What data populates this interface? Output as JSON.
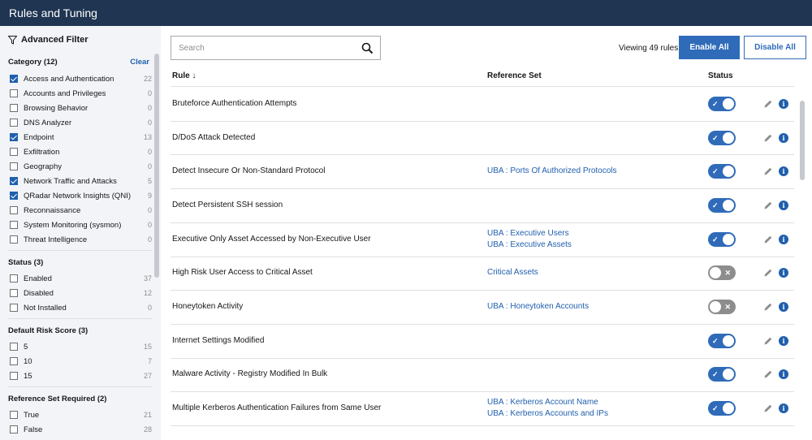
{
  "app": {
    "title": "Rules and Tuning"
  },
  "sidebar": {
    "title": "Advanced Filter",
    "clear_label": "Clear",
    "groups": [
      {
        "title": "Category (12)",
        "items": [
          {
            "label": "Access and Authentication",
            "count": "22",
            "checked": true
          },
          {
            "label": "Accounts and Privileges",
            "count": "0",
            "checked": false
          },
          {
            "label": "Browsing Behavior",
            "count": "0",
            "checked": false
          },
          {
            "label": "DNS Analyzer",
            "count": "0",
            "checked": false
          },
          {
            "label": "Endpoint",
            "count": "13",
            "checked": true
          },
          {
            "label": "Exfiltration",
            "count": "0",
            "checked": false
          },
          {
            "label": "Geography",
            "count": "0",
            "checked": false
          },
          {
            "label": "Network Traffic and Attacks",
            "count": "5",
            "checked": true
          },
          {
            "label": "QRadar Network Insights (QNI)",
            "count": "9",
            "checked": true
          },
          {
            "label": "Reconnaissance",
            "count": "0",
            "checked": false
          },
          {
            "label": "System Monitoring (sysmon)",
            "count": "0",
            "checked": false
          },
          {
            "label": "Threat Intelligence",
            "count": "0",
            "checked": false
          }
        ]
      },
      {
        "title": "Status (3)",
        "items": [
          {
            "label": "Enabled",
            "count": "37",
            "checked": false
          },
          {
            "label": "Disabled",
            "count": "12",
            "checked": false
          },
          {
            "label": "Not Installed",
            "count": "0",
            "checked": false
          }
        ]
      },
      {
        "title": "Default Risk Score (3)",
        "items": [
          {
            "label": "5",
            "count": "15",
            "checked": false
          },
          {
            "label": "10",
            "count": "7",
            "checked": false
          },
          {
            "label": "15",
            "count": "27",
            "checked": false
          }
        ]
      },
      {
        "title": "Reference Set Required (2)",
        "items": [
          {
            "label": "True",
            "count": "21",
            "checked": false
          },
          {
            "label": "False",
            "count": "28",
            "checked": false
          }
        ]
      }
    ]
  },
  "toolbar": {
    "search_placeholder": "Search",
    "viewing_text": "Viewing 49 rules",
    "enable_all_label": "Enable All",
    "disable_all_label": "Disable All"
  },
  "table": {
    "columns": {
      "rule": "Rule ↓",
      "reference_set": "Reference Set",
      "status": "Status"
    },
    "rows": [
      {
        "rule": "Bruteforce Authentication Attempts",
        "refs": [],
        "enabled": true
      },
      {
        "rule": "D/DoS Attack Detected",
        "refs": [],
        "enabled": true
      },
      {
        "rule": "Detect Insecure Or Non-Standard Protocol",
        "refs": [
          "UBA : Ports Of Authorized Protocols"
        ],
        "enabled": true
      },
      {
        "rule": "Detect Persistent SSH session",
        "refs": [],
        "enabled": true
      },
      {
        "rule": "Executive Only Asset Accessed by Non-Executive User",
        "refs": [
          "UBA : Executive Users",
          "UBA : Executive Assets"
        ],
        "enabled": true
      },
      {
        "rule": "High Risk User Access to Critical Asset",
        "refs": [
          "Critical Assets"
        ],
        "enabled": false
      },
      {
        "rule": "Honeytoken Activity",
        "refs": [
          "UBA : Honeytoken Accounts"
        ],
        "enabled": false
      },
      {
        "rule": "Internet Settings Modified",
        "refs": [],
        "enabled": true
      },
      {
        "rule": "Malware Activity - Registry Modified In Bulk",
        "refs": [],
        "enabled": true
      },
      {
        "rule": "Multiple Kerberos Authentication Failures from Same User",
        "refs": [
          "UBA : Kerberos Account Name",
          "UBA : Kerberos Accounts and IPs"
        ],
        "enabled": true
      }
    ]
  },
  "icons": {
    "filter": "filter-icon",
    "search": "search-icon",
    "edit": "pencil-icon",
    "info": "info-icon",
    "sort": "arrow-down-icon"
  },
  "colors": {
    "topbar": "#1f3552",
    "accent": "#2f6bb9",
    "link": "#1f5fad",
    "toggle_off": "#8d8d8d"
  }
}
